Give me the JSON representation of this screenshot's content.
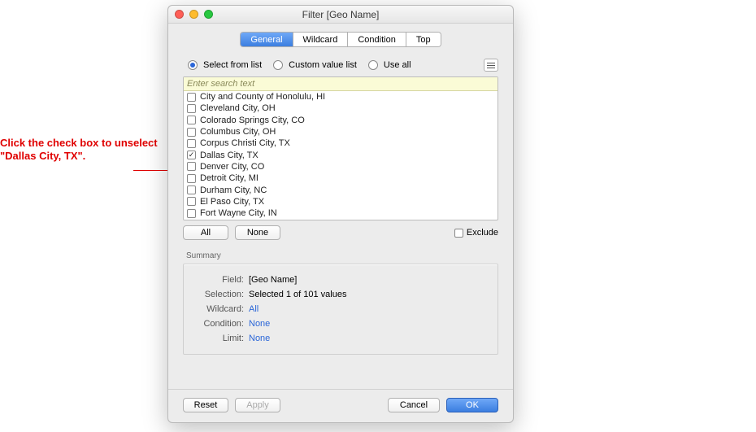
{
  "annotation": "Click the check box to unselect \"Dallas City, TX\".",
  "window_title": "Filter [Geo Name]",
  "tabs": {
    "general": "General",
    "wildcard": "Wildcard",
    "condition": "Condition",
    "top": "Top"
  },
  "modes": {
    "select_from_list": "Select from list",
    "custom_value_list": "Custom value list",
    "use_all": "Use all"
  },
  "search_placeholder": "Enter search text",
  "items": [
    {
      "label": "City and County of Honolulu, HI",
      "checked": false
    },
    {
      "label": "Cleveland City, OH",
      "checked": false
    },
    {
      "label": "Colorado Springs City, CO",
      "checked": false
    },
    {
      "label": "Columbus City, OH",
      "checked": false
    },
    {
      "label": "Corpus Christi City, TX",
      "checked": false
    },
    {
      "label": "Dallas City, TX",
      "checked": true
    },
    {
      "label": "Denver City, CO",
      "checked": false
    },
    {
      "label": "Detroit City, MI",
      "checked": false
    },
    {
      "label": "Durham City, NC",
      "checked": false
    },
    {
      "label": "El Paso City, TX",
      "checked": false
    },
    {
      "label": "Fort Wayne City, IN",
      "checked": false
    }
  ],
  "buttons": {
    "all": "All",
    "none": "None",
    "exclude": "Exclude",
    "reset": "Reset",
    "apply": "Apply",
    "cancel": "Cancel",
    "ok": "OK"
  },
  "summary": {
    "heading": "Summary",
    "field_k": "Field:",
    "field_v": "[Geo Name]",
    "selection_k": "Selection:",
    "selection_v": "Selected 1 of 101 values",
    "wildcard_k": "Wildcard:",
    "wildcard_v": "All",
    "condition_k": "Condition:",
    "condition_v": "None",
    "limit_k": "Limit:",
    "limit_v": "None"
  }
}
